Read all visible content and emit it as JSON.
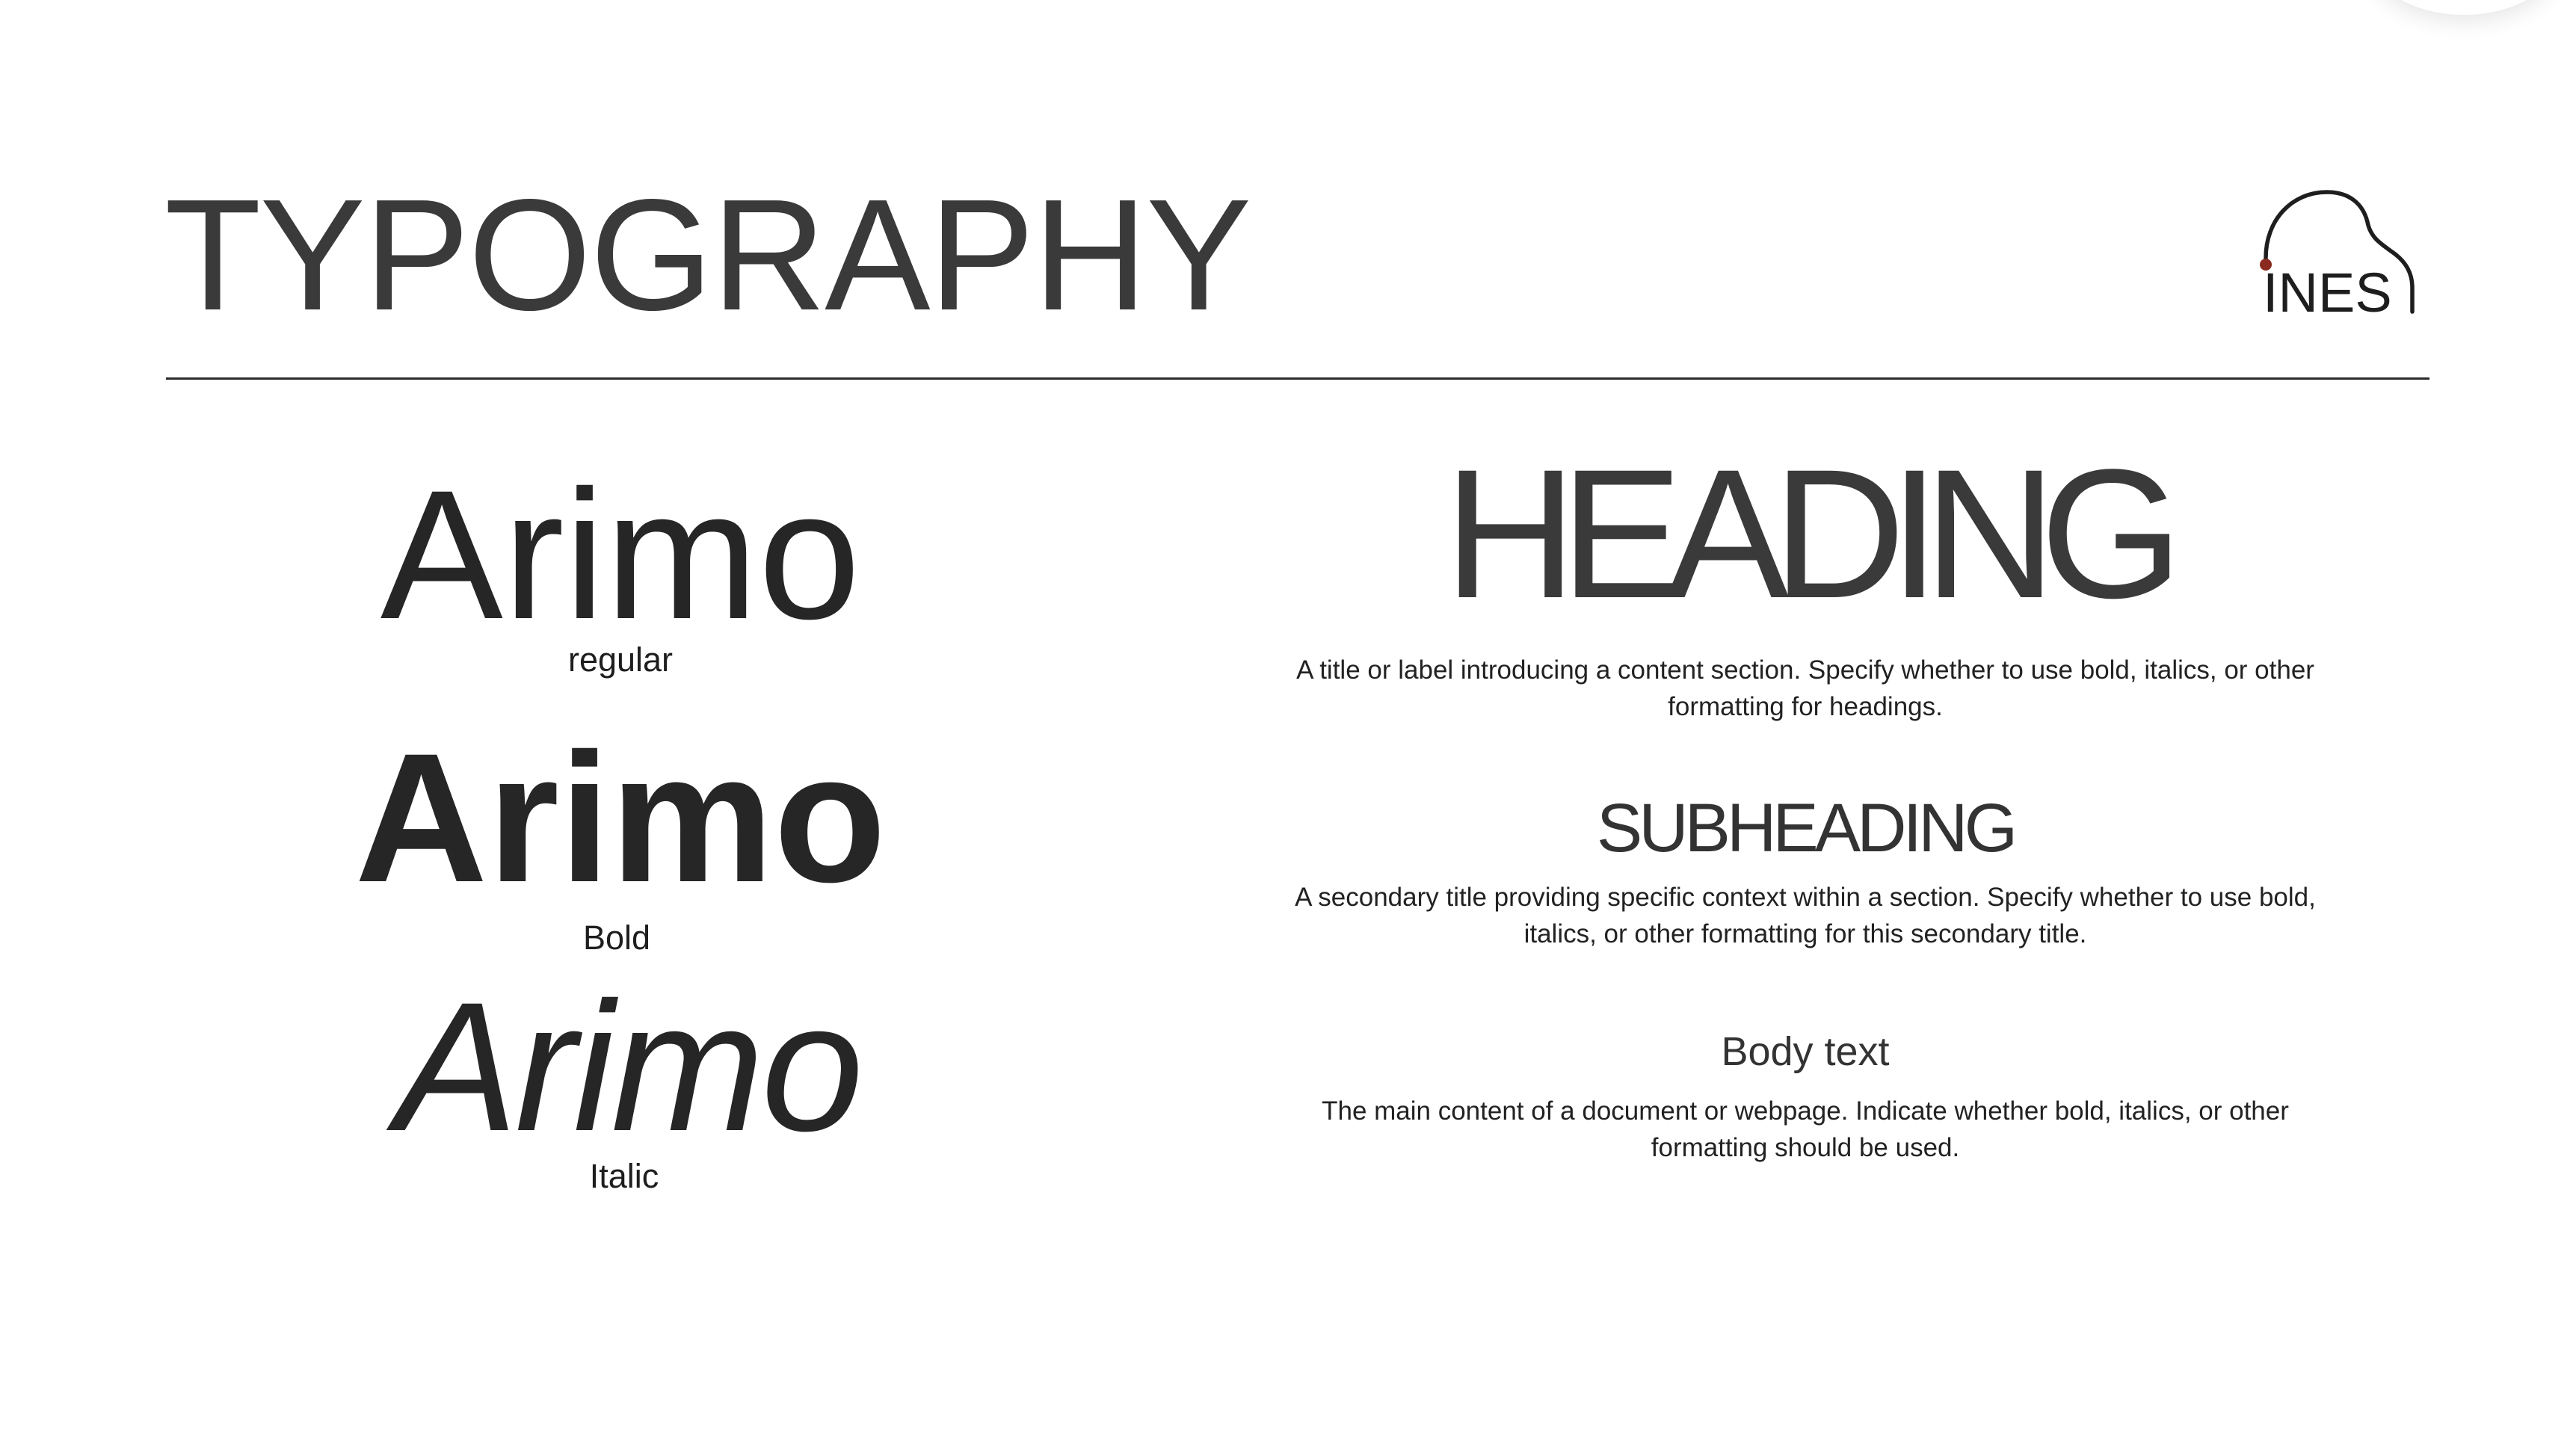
{
  "page": {
    "title": "TYPOGRAPHY"
  },
  "logo": {
    "text": "INES",
    "accent_color": "#8b2a1e"
  },
  "font_samples": [
    {
      "word": "Arimo",
      "style": "regular"
    },
    {
      "word": "Arimo",
      "style": "Bold"
    },
    {
      "word": "Arimo",
      "style": "Italic"
    }
  ],
  "type_scale": {
    "heading": {
      "label": "HEADING",
      "description": "A title or label introducing a content section. Specify whether to use bold, italics, or other formatting for headings."
    },
    "subheading": {
      "label": "SUBHEADING",
      "description": "A secondary title providing specific context within a section. Specify whether to use bold, italics, or other formatting for this secondary title."
    },
    "body": {
      "label": "Body text",
      "description": "The main content of a document or webpage. Indicate whether bold, italics, or other formatting should be used."
    }
  },
  "colors": {
    "text_dark": "#333333",
    "divider": "#2b2b2b",
    "background": "#ffffff"
  }
}
